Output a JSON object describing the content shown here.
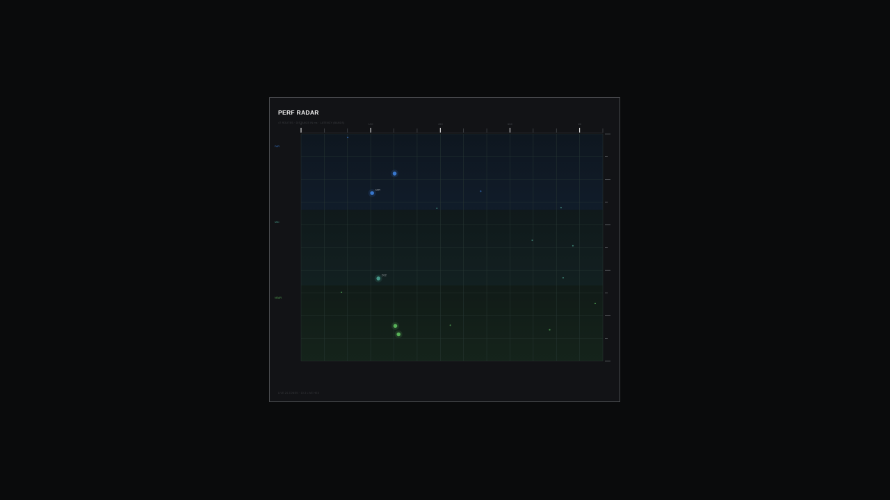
{
  "title": "PERF RADAR",
  "subtitle": "47 ROUTES · DISTANCE IN ms · LATENCY (BANDS)",
  "footer": "LIVE 24 ZONES · 10.3 LIVE HEX",
  "colors": {
    "background": "#0a0b0c",
    "panel": "#121316",
    "far": "#3a7bd5",
    "mid": "#4a9e8e",
    "near": "#5cb85c",
    "grid": "#2a3a36"
  },
  "chart_data": {
    "type": "scatter",
    "title": "PERF RADAR",
    "xlim": [
      0,
      130
    ],
    "ylim": [
      0,
      100
    ],
    "x_tick_labels": [
      {
        "value": 0,
        "label": "0"
      },
      {
        "value": 30,
        "label": "1/10"
      },
      {
        "value": 60,
        "label": "4/10"
      },
      {
        "value": 90,
        "label": "6/10"
      },
      {
        "value": 120,
        "label": "1/6"
      }
    ],
    "bands": [
      {
        "name": "FAR",
        "from": 66.7,
        "to": 100,
        "color": "#3a7bd5"
      },
      {
        "name": "MID",
        "from": 33.3,
        "to": 66.7,
        "color": "#4a9e8e"
      },
      {
        "name": "NEAR",
        "from": 0,
        "to": 33.3,
        "color": "#5cb85c"
      }
    ],
    "grid": true,
    "points": [
      {
        "x": 40.3,
        "y": 82.6,
        "size": "large",
        "band": "far",
        "label": ""
      },
      {
        "x": 30.6,
        "y": 74.0,
        "size": "large",
        "band": "far",
        "label": "D84"
      },
      {
        "x": 20.1,
        "y": 98.5,
        "size": "small",
        "band": "far",
        "label": ""
      },
      {
        "x": 77.4,
        "y": 74.8,
        "size": "small",
        "band": "far",
        "label": ""
      },
      {
        "x": 58.5,
        "y": 67.3,
        "size": "small",
        "band": "mid",
        "label": ""
      },
      {
        "x": 112.0,
        "y": 67.6,
        "size": "small",
        "band": "mid",
        "label": ""
      },
      {
        "x": 99.6,
        "y": 53.2,
        "size": "small",
        "band": "mid",
        "label": ""
      },
      {
        "x": 117.1,
        "y": 50.8,
        "size": "small",
        "band": "mid",
        "label": ""
      },
      {
        "x": 112.9,
        "y": 36.7,
        "size": "small",
        "band": "mid",
        "label": ""
      },
      {
        "x": 33.3,
        "y": 36.4,
        "size": "large",
        "band": "mid",
        "label": "D12"
      },
      {
        "x": 17.4,
        "y": 30.3,
        "size": "small",
        "band": "near",
        "label": ""
      },
      {
        "x": 126.7,
        "y": 25.4,
        "size": "small",
        "band": "near",
        "label": ""
      },
      {
        "x": 40.6,
        "y": 15.5,
        "size": "large",
        "band": "near",
        "label": ""
      },
      {
        "x": 64.3,
        "y": 15.8,
        "size": "small",
        "band": "near",
        "label": ""
      },
      {
        "x": 107.1,
        "y": 13.8,
        "size": "small",
        "band": "near",
        "label": ""
      },
      {
        "x": 42.0,
        "y": 11.8,
        "size": "large",
        "band": "near",
        "label": ""
      }
    ]
  }
}
